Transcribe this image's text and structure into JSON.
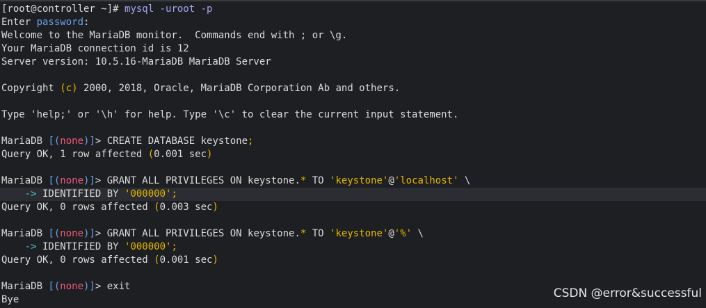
{
  "terminal": {
    "l1": {
      "prompt": "[root@controller ~]# ",
      "cmd": "mysql -uroot -p"
    },
    "l2": {
      "a": "Enter ",
      "b": "password",
      "c": ":"
    },
    "l3": "Welcome to the MariaDB monitor.  Commands end with ; or \\g.",
    "l4": "Your MariaDB connection id is 12",
    "l5": "Server version: 10.5.16-MariaDB MariaDB Server",
    "l7": {
      "a": "Copyright ",
      "b": "(c)",
      "c": " 2000, 2018, Oracle, MariaDB Corporation Ab and others."
    },
    "l9": "Type 'help;' or '\\h' for help. Type '\\c' to clear the current input statement.",
    "l11": {
      "a": "MariaDB ",
      "b1": "[(",
      "none": "none",
      "b2": ")]",
      "c": "> CREATE DATABASE keystone",
      "semi": ";"
    },
    "l12": {
      "a": "Query OK, 1 row affected ",
      "p1": "(",
      "b": "0.001 sec",
      "p2": ")"
    },
    "l14": {
      "a": "MariaDB ",
      "b1": "[(",
      "none": "none",
      "b2": ")]",
      "c": "> GRANT ALL PRIVILEGES ON keystone",
      "dot": ".",
      "star": "*",
      "d": " TO ",
      "s1": "'keystone'",
      "at": "@",
      "s2": "'localhost'",
      "e": " \\"
    },
    "l15": {
      "indent": "    ",
      "arrow": "->",
      "a": " IDENTIFIED BY ",
      "s": "'000000'",
      "semi": ";"
    },
    "l16": {
      "a": "Query OK, 0 rows affected ",
      "p1": "(",
      "b": "0.003 sec",
      "p2": ")"
    },
    "l18": {
      "a": "MariaDB ",
      "b1": "[(",
      "none": "none",
      "b2": ")]",
      "c": "> GRANT ALL PRIVILEGES ON keystone",
      "dot": ".",
      "star": "*",
      "d": " TO ",
      "s1": "'keystone'",
      "at": "@",
      "s2": "'%'",
      "e": " \\"
    },
    "l19": {
      "indent": "    ",
      "arrow": "->",
      "a": " IDENTIFIED BY ",
      "s": "'000000'",
      "semi": ";"
    },
    "l20": {
      "a": "Query OK, 0 rows affected ",
      "p1": "(",
      "b": "0.001 sec",
      "p2": ")"
    },
    "l22": {
      "a": "MariaDB ",
      "b1": "[(",
      "none": "none",
      "b2": ")]",
      "c": "> exit"
    },
    "l23": "Bye"
  },
  "watermark": "CSDN @error&successful",
  "colors": {
    "background": "#1e1f22",
    "text": "#dcdcdc",
    "command": "#a3a6f5",
    "keyword_blue": "#6aa0f0",
    "none_red": "#ef5a78",
    "string_yellow": "#e6b800",
    "arrow_cyan": "#4ec0d8"
  }
}
